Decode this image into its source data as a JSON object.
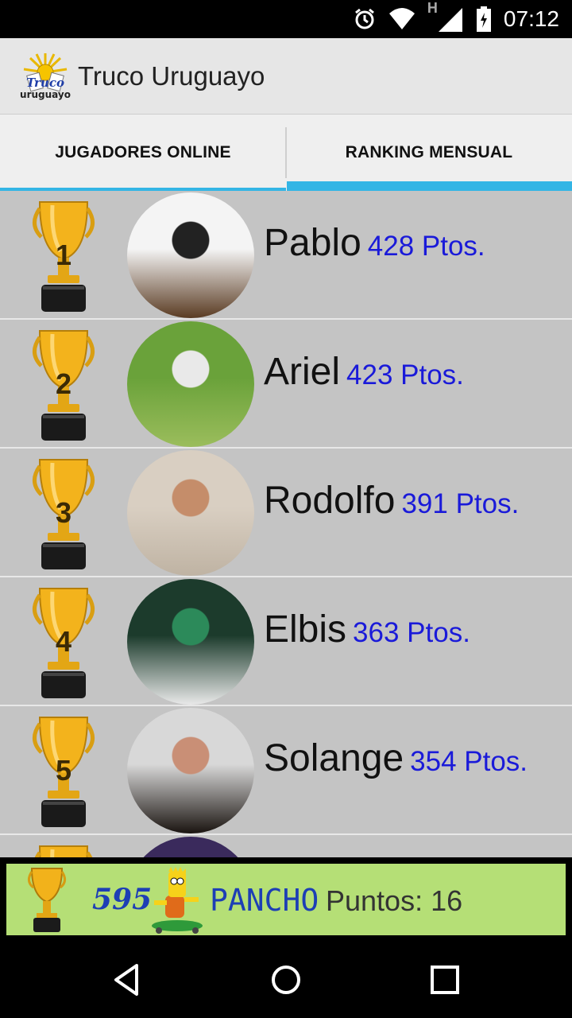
{
  "status_bar": {
    "time": "07:12",
    "network_letter": "H"
  },
  "app": {
    "title": "Truco Uruguayo",
    "logo_text_top": "Truco",
    "logo_text_bottom": "uruguayo"
  },
  "tabs": [
    {
      "label": "JUGADORES ONLINE",
      "selected": false
    },
    {
      "label": "RANKING MENSUAL",
      "selected": true
    }
  ],
  "ranking": [
    {
      "rank": "1",
      "name": "Pablo",
      "points": "428 Ptos.",
      "avatar_colors": [
        "#f4f4f4",
        "#5a3b22",
        "#222222"
      ]
    },
    {
      "rank": "2",
      "name": "Ariel",
      "points": "423 Ptos.",
      "avatar_colors": [
        "#6aa23a",
        "#9bbd5c",
        "#e9e9e9"
      ]
    },
    {
      "rank": "3",
      "name": "Rodolfo",
      "points": "391 Ptos.",
      "avatar_colors": [
        "#d9cfc2",
        "#bfb3a3",
        "#c58d6a"
      ]
    },
    {
      "rank": "4",
      "name": "Elbis",
      "points": "363 Ptos.",
      "avatar_colors": [
        "#1c3b2c",
        "#e9e9e9",
        "#2c8a5a"
      ]
    },
    {
      "rank": "5",
      "name": "Solange",
      "points": "354 Ptos.",
      "avatar_colors": [
        "#d8d8d8",
        "#1a1410",
        "#c98f76"
      ]
    },
    {
      "rank": "",
      "name": "",
      "points": "",
      "avatar_colors": [
        "#3a2a5c",
        "#3a2a5c",
        "#3a2a5c"
      ]
    }
  ],
  "current_user": {
    "rank": "595",
    "name": "PANCHO",
    "points_label": "Puntos: 16"
  },
  "colors": {
    "accent": "#33b5e5",
    "points_text": "#1a1ad9",
    "user_bar": "#b5df76"
  },
  "icons": [
    "alarm-icon",
    "wifi-icon",
    "signal-icon",
    "battery-icon",
    "trophy-icon",
    "back-icon",
    "home-icon",
    "recents-icon"
  ]
}
